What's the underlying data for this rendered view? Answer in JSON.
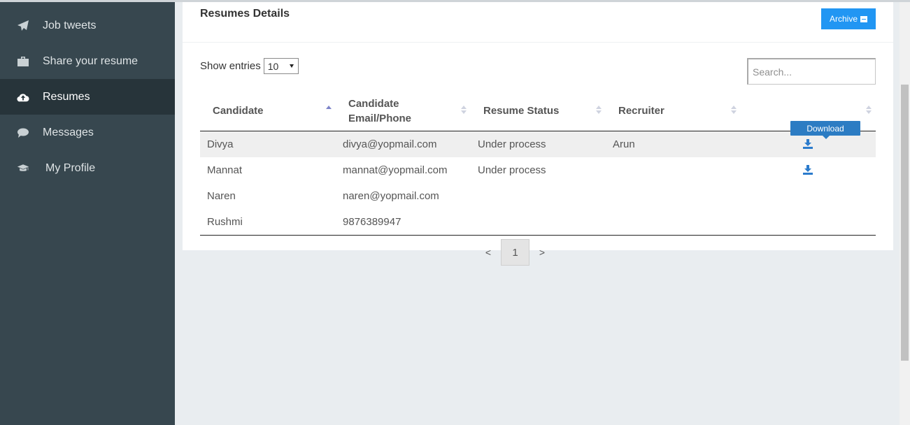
{
  "sidebar": {
    "items": [
      {
        "label": "Job tweets",
        "icon": "paper-plane-icon"
      },
      {
        "label": "Share your resume",
        "icon": "briefcase-icon"
      },
      {
        "label": "Resumes",
        "icon": "cloud-upload-icon",
        "active": true
      },
      {
        "label": "Messages",
        "icon": "chat-bubble-icon"
      },
      {
        "label": "My Profile",
        "icon": "graduation-cap-icon"
      }
    ]
  },
  "card": {
    "title": "Resumes Details",
    "archive_label": "Archive"
  },
  "controls": {
    "show_entries_label": "Show entries",
    "entries_value": "10",
    "search_placeholder": "Search..."
  },
  "table": {
    "headers": [
      "Candidate",
      "Candidate Email/Phone",
      "Resume Status",
      "Recruiter",
      ""
    ],
    "rows": [
      {
        "candidate": "Divya",
        "contact": "divya@yopmail.com",
        "status": "Under process",
        "recruiter": "Arun",
        "download": true
      },
      {
        "candidate": "Mannat",
        "contact": "mannat@yopmail.com",
        "status": "Under process",
        "recruiter": "",
        "download": true
      },
      {
        "candidate": "Naren",
        "contact": "naren@yopmail.com",
        "status": "",
        "recruiter": "",
        "download": false
      },
      {
        "candidate": "Rushmi",
        "contact": "9876389947",
        "status": "",
        "recruiter": "",
        "download": false
      }
    ],
    "tooltip": "Download"
  },
  "pagination": {
    "prev": "<",
    "current": "1",
    "next": ">"
  },
  "colors": {
    "sidebar_bg": "#37474f",
    "sidebar_active": "#27343a",
    "accent": "#2196f3",
    "tooltip": "#2c7cc3"
  }
}
